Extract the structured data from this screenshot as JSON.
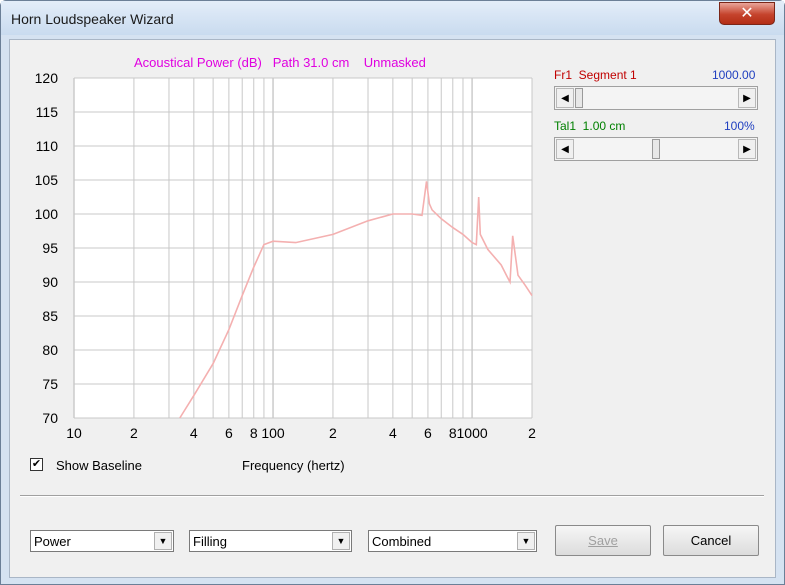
{
  "window": {
    "title": "Horn Loudspeaker Wizard",
    "close_glyph": "✕"
  },
  "chart_header": "Acoustical Power (dB)   Path 31.0 cm    Unmasked",
  "parameters": {
    "fr1": {
      "name": "Fr1  Segment 1",
      "value": "1000.00",
      "slider_value": 100
    },
    "tal1": {
      "name": "Tal1  1.00 cm",
      "value": "100%",
      "slider_value": 50
    }
  },
  "show_baseline": {
    "label": "Show Baseline",
    "checked": true,
    "check_glyph": "✔"
  },
  "frequency_label": "Frequency (hertz)",
  "dropdowns": [
    {
      "value": "Power",
      "arrow": "▼"
    },
    {
      "value": "Filling",
      "arrow": "▼"
    },
    {
      "value": "Combined",
      "arrow": "▼"
    }
  ],
  "buttons": {
    "save": "Save",
    "cancel": "Cancel"
  },
  "colors": {
    "curve": "#f4b0b0",
    "title": "#e000e0",
    "grid": "#c8c8c8"
  },
  "chart_data": {
    "type": "line",
    "x_scale": "log",
    "xlim": [
      10,
      2000
    ],
    "ylim": [
      70,
      120
    ],
    "y_ticks": [
      "120",
      "115",
      "110",
      "105",
      "100",
      "95",
      "90",
      "85",
      "80",
      "75",
      "70"
    ],
    "x_ticks": [
      {
        "v": 10,
        "label": "10"
      },
      {
        "v": 20,
        "label": "2"
      },
      {
        "v": 40,
        "label": "4"
      },
      {
        "v": 60,
        "label": "6"
      },
      {
        "v": 80,
        "label": "8"
      },
      {
        "v": 100,
        "label": "100"
      },
      {
        "v": 200,
        "label": "2"
      },
      {
        "v": 400,
        "label": "4"
      },
      {
        "v": 600,
        "label": "6"
      },
      {
        "v": 800,
        "label": "8"
      },
      {
        "v": 1000,
        "label": "1000"
      },
      {
        "v": 2000,
        "label": "2"
      }
    ],
    "series": [
      {
        "x": [
          34,
          40,
          50,
          60,
          70,
          80,
          90,
          100,
          130,
          200,
          300,
          400,
          500,
          560,
          590,
          610,
          630,
          700,
          800,
          900,
          1000,
          1050,
          1080,
          1100,
          1200,
          1400,
          1500,
          1550,
          1600,
          1700,
          1850,
          2000
        ],
        "y": [
          70,
          73.3,
          78.0,
          83.0,
          88.0,
          92.2,
          95.5,
          96.0,
          95.8,
          97.0,
          99.0,
          100.0,
          100.0,
          99.8,
          104.8,
          101.5,
          100.6,
          99.3,
          98.0,
          97.0,
          95.8,
          95.5,
          102.5,
          97.0,
          94.8,
          92.5,
          90.8,
          90.0,
          96.8,
          91.0,
          89.5,
          88.0
        ]
      }
    ]
  }
}
